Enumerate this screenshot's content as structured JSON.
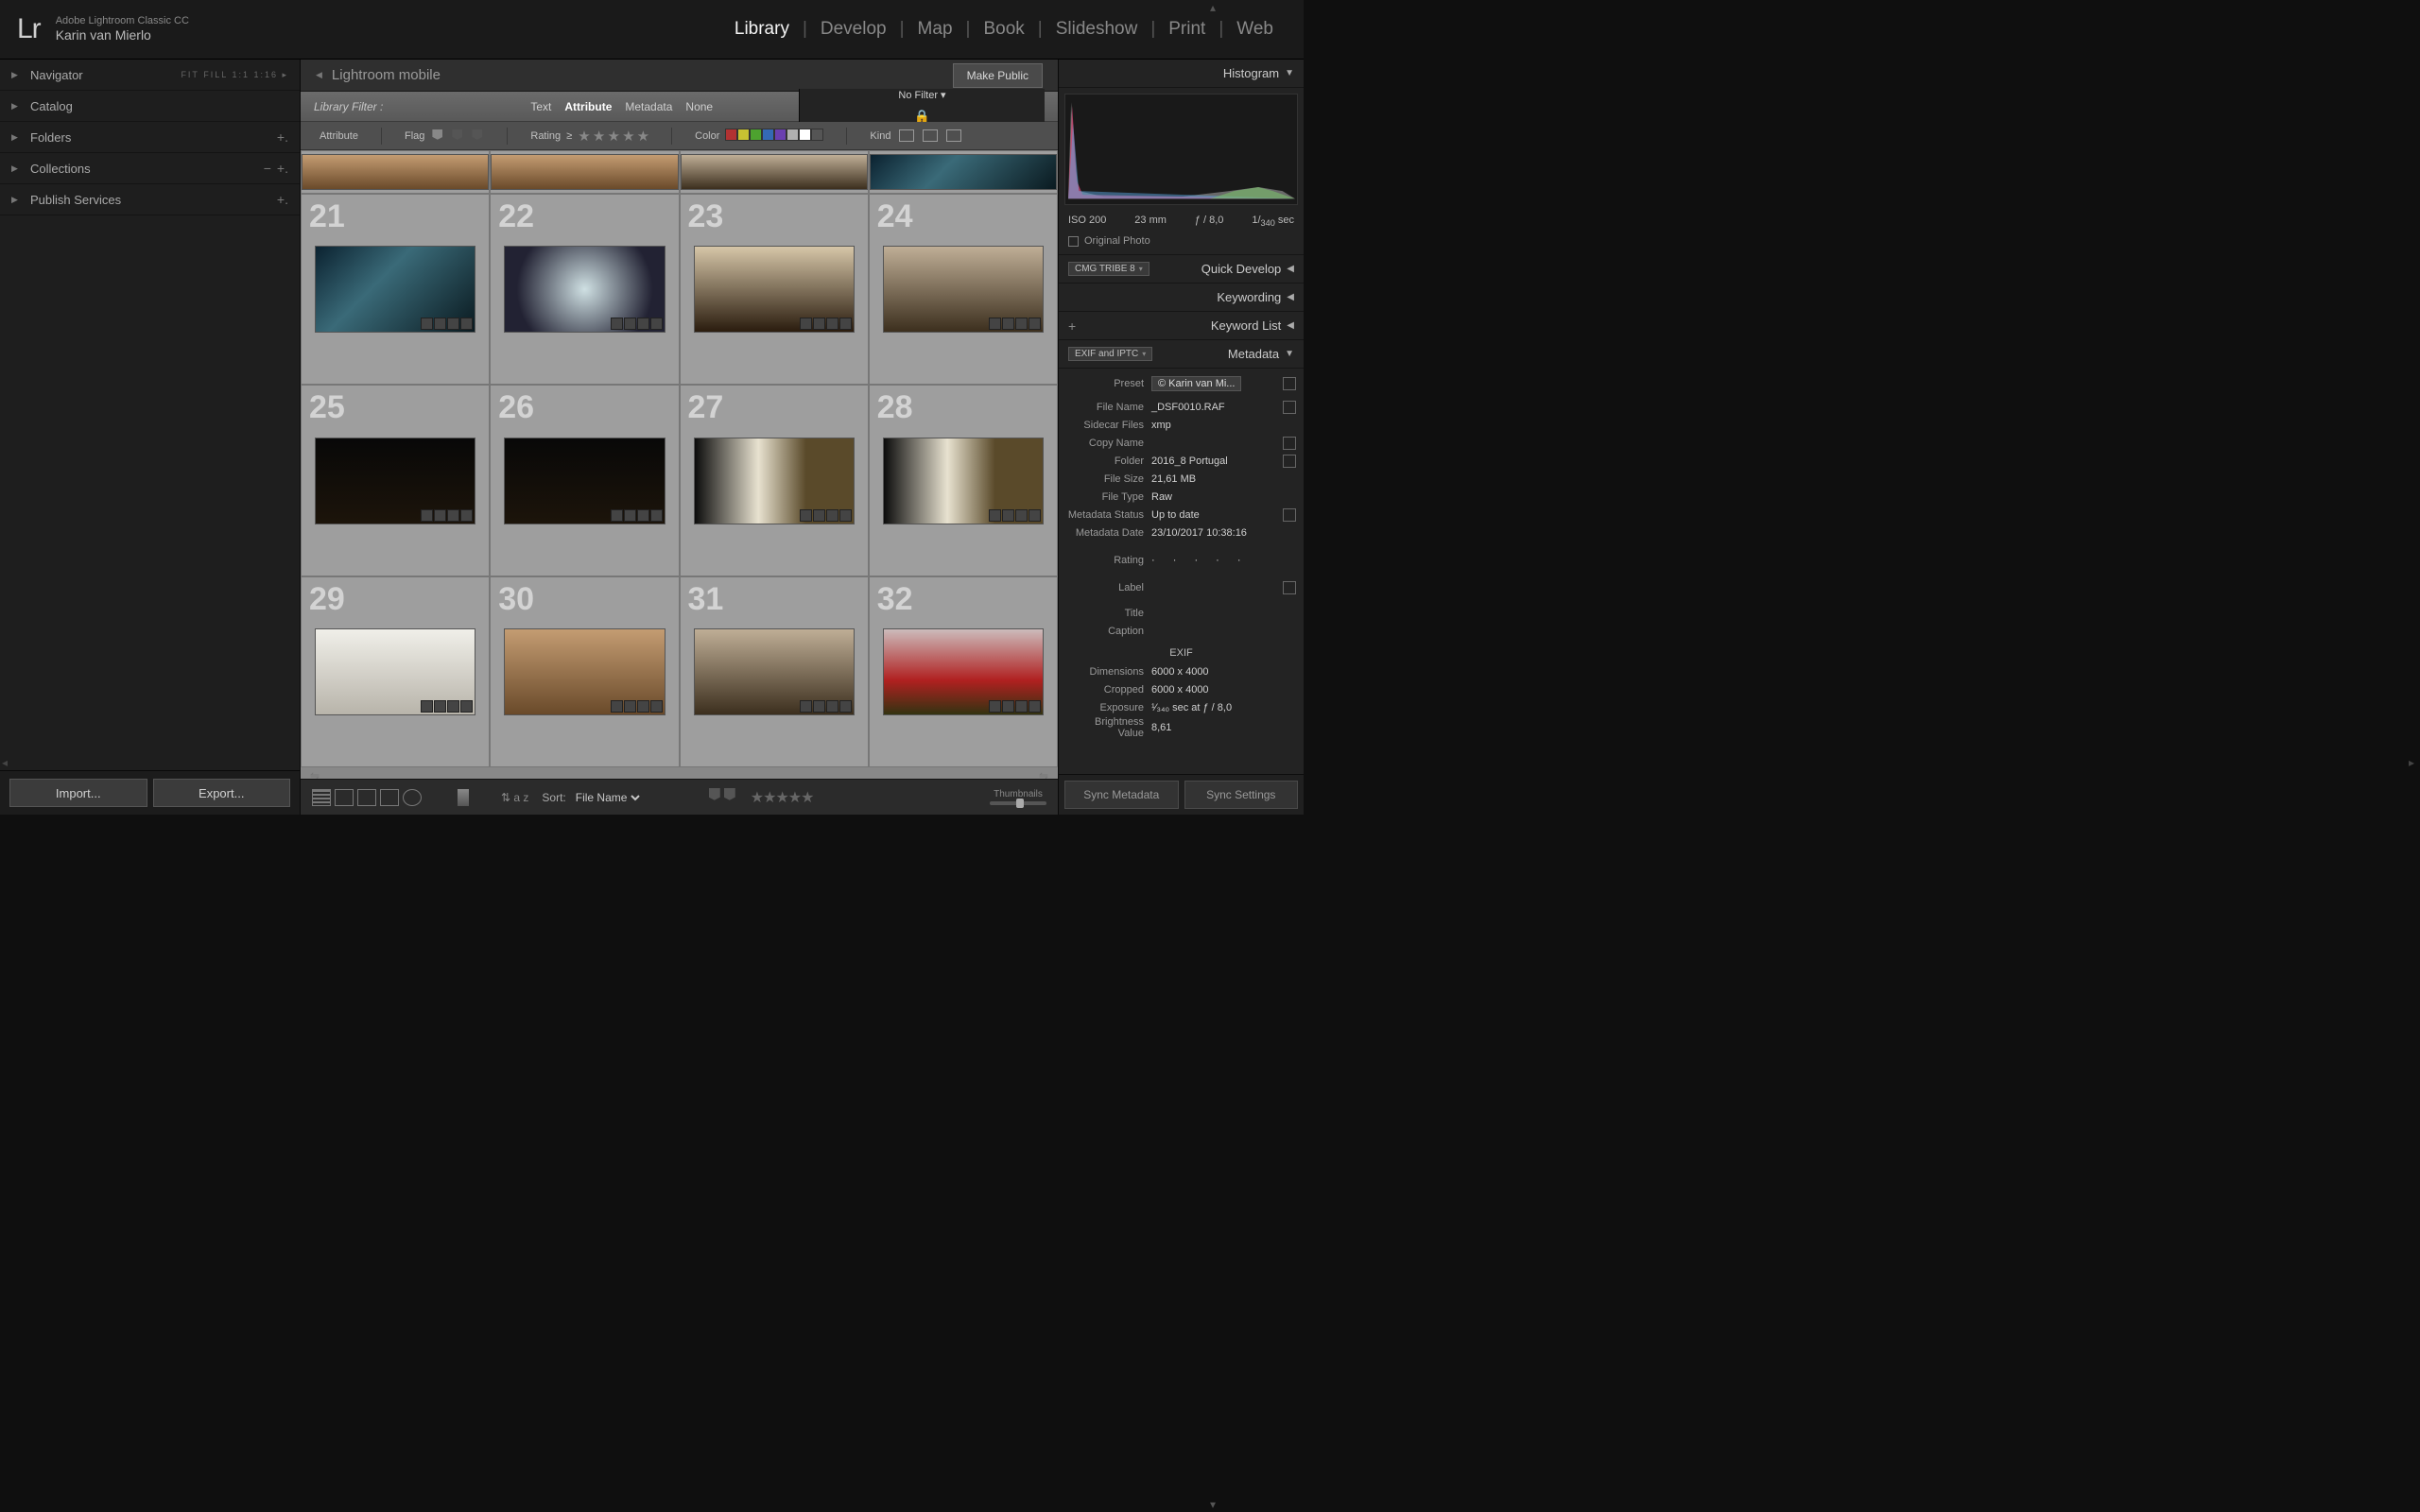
{
  "header": {
    "app_name": "Adobe Lightroom Classic CC",
    "identity": "Karin van Mierlo",
    "logo_text": "Lr",
    "modules": [
      "Library",
      "Develop",
      "Map",
      "Book",
      "Slideshow",
      "Print",
      "Web"
    ],
    "active_module": "Library"
  },
  "left_panel": {
    "sections": [
      {
        "title": "Navigator",
        "suffix": "FIT  FILL  1:1  1:16",
        "suffix_chev": "▸"
      },
      {
        "title": "Catalog"
      },
      {
        "title": "Folders",
        "add": true
      },
      {
        "title": "Collections",
        "add": true,
        "remove": true
      },
      {
        "title": "Publish Services",
        "add": true
      }
    ],
    "import_label": "Import...",
    "export_label": "Export..."
  },
  "collection_bar": {
    "name": "Lightroom mobile",
    "make_public": "Make Public"
  },
  "filter_bar": {
    "label": "Library Filter :",
    "tabs": [
      "Text",
      "Attribute",
      "Metadata",
      "None"
    ],
    "active_tab": "Attribute",
    "no_filter": "No Filter"
  },
  "attr_bar": {
    "attribute": "Attribute",
    "flag": "Flag",
    "rating": "Rating",
    "rating_op": "≥",
    "color": "Color",
    "swatches": [
      "#b23232",
      "#c7c132",
      "#4da22f",
      "#3469b5",
      "#6a3fb0",
      "#b0b0b0",
      "#ffffff",
      "#555555"
    ],
    "kind": "Kind"
  },
  "grid": {
    "start_index": 21,
    "items": [
      {
        "n": 21,
        "cls": "t-blue"
      },
      {
        "n": 22,
        "cls": "t-spike"
      },
      {
        "n": 23,
        "cls": "t-street"
      },
      {
        "n": 24,
        "cls": "t-arch"
      },
      {
        "n": 25,
        "cls": "t-dark"
      },
      {
        "n": 26,
        "cls": "t-dark"
      },
      {
        "n": 27,
        "cls": "t-int"
      },
      {
        "n": 28,
        "cls": "t-int"
      },
      {
        "n": 29,
        "cls": "t-white"
      },
      {
        "n": 30,
        "cls": "t-warm"
      },
      {
        "n": 31,
        "cls": "t-arch"
      },
      {
        "n": 32,
        "cls": "t-red"
      }
    ]
  },
  "toolbar": {
    "sort_label": "Sort:",
    "sort_value": "File Name",
    "thumb_label": "Thumbnails"
  },
  "right_panel": {
    "histogram_title": "Histogram",
    "exif": {
      "iso": "ISO 200",
      "focal": "23 mm",
      "aperture": "ƒ / 8,0",
      "shutter_pre": "1/",
      "shutter_sub": "340",
      "shutter_suf": " sec"
    },
    "orig_photo": "Original Photo",
    "quick_dev": {
      "chip": "CMG TRIBE 8",
      "title": "Quick Develop"
    },
    "keywording": "Keywording",
    "keyword_list": "Keyword List",
    "metadata": {
      "chip": "EXIF and IPTC",
      "title": "Metadata",
      "preset_label": "Preset",
      "preset_value": "© Karin van Mi...",
      "rows": [
        {
          "k": "File Name",
          "v": "_DSF0010.RAF",
          "box": true
        },
        {
          "k": "Sidecar Files",
          "v": "xmp"
        },
        {
          "k": "Copy Name",
          "v": "",
          "box": true
        },
        {
          "k": "Folder",
          "v": "2016_8 Portugal",
          "box": true
        },
        {
          "k": "File Size",
          "v": "21,61 MB"
        },
        {
          "k": "File Type",
          "v": "Raw"
        },
        {
          "k": "Metadata Status",
          "v": "Up to date",
          "box": true
        },
        {
          "k": "Metadata Date",
          "v": "23/10/2017 10:38:16"
        }
      ],
      "rating_label": "Rating",
      "rating_value": "·  ·  ·  ·  ·",
      "label_label": "Label",
      "title_label": "Title",
      "caption_label": "Caption",
      "exif_section": "EXIF",
      "exif_rows": [
        {
          "k": "Dimensions",
          "v": "6000 x 4000"
        },
        {
          "k": "Cropped",
          "v": "6000 x 4000"
        },
        {
          "k": "Exposure",
          "v": "¹⁄₃₄₀ sec at ƒ / 8,0"
        },
        {
          "k": "Brightness Value",
          "v": "8,61"
        }
      ]
    },
    "sync_metadata": "Sync Metadata",
    "sync_settings": "Sync Settings"
  }
}
